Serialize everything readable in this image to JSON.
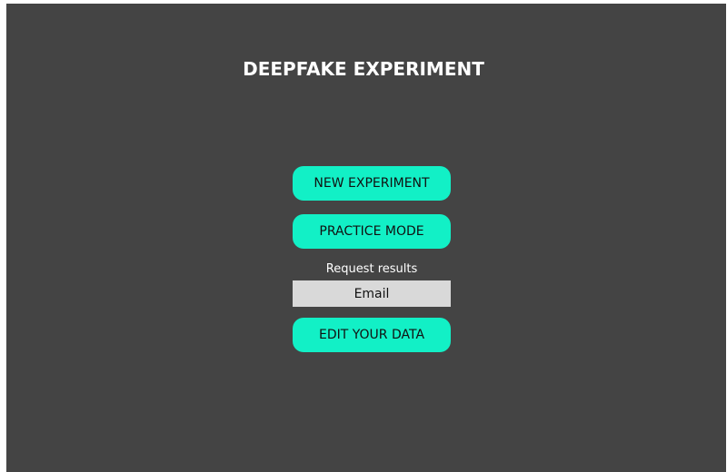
{
  "page": {
    "title": "DEEPFAKE EXPERIMENT"
  },
  "buttons": {
    "new_experiment": "NEW EXPERIMENT",
    "practice_mode": "PRACTICE MODE",
    "edit_data": "EDIT YOUR DATA"
  },
  "request": {
    "label": "Request results",
    "email_placeholder": "Email"
  },
  "colors": {
    "background": "#444444",
    "accent": "#12f0c6",
    "input_bg": "#d9d9d9",
    "title_text": "#ffffff"
  }
}
